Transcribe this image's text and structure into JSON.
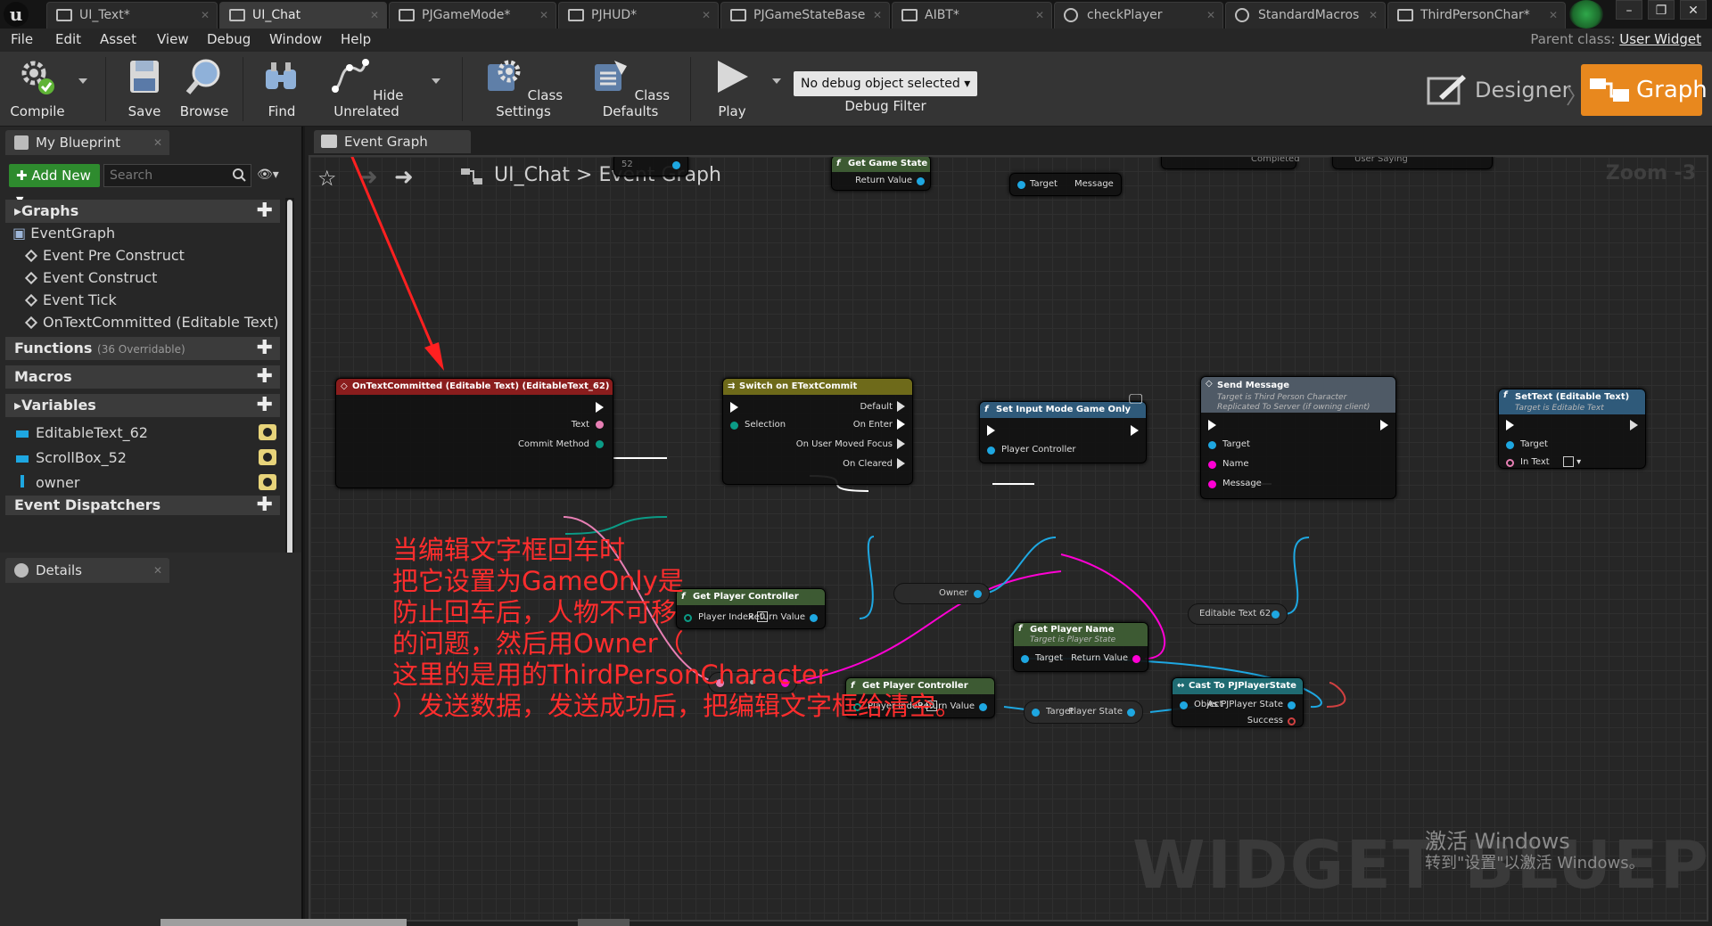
{
  "tabs": [
    {
      "label": "UI_Text*"
    },
    {
      "label": "UI_Chat"
    },
    {
      "label": "PJGameMode*"
    },
    {
      "label": "PJHUD*"
    },
    {
      "label": "PJGameStateBase"
    },
    {
      "label": "AIBT*"
    },
    {
      "label": "checkPlayer"
    },
    {
      "label": "StandardMacros"
    },
    {
      "label": "ThirdPersonChar*"
    }
  ],
  "menu": [
    "File",
    "Edit",
    "Asset",
    "View",
    "Debug",
    "Window",
    "Help"
  ],
  "parent_class": {
    "label": "Parent class:",
    "value": "User Widget"
  },
  "toolbar": {
    "compile": "Compile",
    "save": "Save",
    "browse": "Browse",
    "find": "Find",
    "hide_unrelated": "Hide Unrelated",
    "class_settings": "Class Settings",
    "class_defaults": "Class Defaults",
    "play": "Play",
    "debug_select": "No debug object selected",
    "debug_filter": "Debug Filter",
    "designer": "Designer",
    "graph": "Graph"
  },
  "my_blueprint": {
    "tab": "My Blueprint",
    "add_new": "Add New",
    "search_placeholder": "Search",
    "graphs": "Graphs",
    "event_graph": "EventGraph",
    "events": [
      "Event Pre Construct",
      "Event Construct",
      "Event Tick",
      "OnTextCommitted (Editable Text)"
    ],
    "functions": "Functions",
    "functions_sub": "(36 Overridable)",
    "macros": "Macros",
    "variables": "Variables",
    "vars": [
      "EditableText_62",
      "ScrollBox_52",
      "owner"
    ],
    "dispatchers": "Event Dispatchers"
  },
  "details": {
    "tab": "Details"
  },
  "graph": {
    "tab": "Event Graph",
    "crumb_bp": "UI_Chat",
    "crumb_sep": ">",
    "crumb_graph": "Event Graph",
    "zoom": "Zoom -3",
    "watermark": "WIDGET BLUEPRINT",
    "activate_line1": "激活 Windows",
    "activate_line2": "转到\"设置\"以激活 Windows。"
  },
  "nodes": {
    "top_get_game_state": {
      "title": "Get Game State",
      "out": "Return Value"
    },
    "top_target": "Target",
    "top_message": "Message",
    "top_completed": "Completed",
    "top_user_saying": "User Saying",
    "top_52": "52",
    "on_text_committed": {
      "title": "OnTextCommitted (Editable Text) (EditableText_62)",
      "text": "Text",
      "commit": "Commit Method"
    },
    "switch": {
      "title": "Switch on ETextCommit",
      "selection": "Selection",
      "default": "Default",
      "on_enter": "On Enter",
      "on_focus": "On User Moved Focus",
      "on_cleared": "On Cleared"
    },
    "set_input": {
      "title": "Set Input Mode Game Only",
      "pc": "Player Controller"
    },
    "send_message": {
      "title": "Send Message",
      "sub1": "Target is Third Person Character",
      "sub2": "Replicated To Server (if owning client)",
      "target": "Target",
      "name": "Name",
      "message": "Message"
    },
    "set_text": {
      "title": "SetText (Editable Text)",
      "sub": "Target is Editable Text",
      "target": "Target",
      "in_text": "In Text"
    },
    "get_pc_1": {
      "title": "Get Player Controller",
      "index": "Player Index",
      "index_val": "0",
      "out": "Return Value"
    },
    "owner": "Owner",
    "editable_text": "Editable Text 62",
    "get_player_name": {
      "title": "Get Player Name",
      "sub": "Target is Player State",
      "target": "Target",
      "out": "Return Value"
    },
    "get_pc_2": {
      "title": "Get Player Controller",
      "index": "Player Index",
      "index_val": "0",
      "out": "Return Value"
    },
    "player_state": {
      "target": "Target",
      "out": "Player State"
    },
    "cast": {
      "title": "Cast To PJPlayerState",
      "object": "Object",
      "as": "As PJPlayer State",
      "success": "Success"
    }
  },
  "annotation": [
    "当编辑文字框回车时",
    "把它设置为GameOnly是",
    "防止回车后，人物不可移",
    "的问题，然后用Owner（",
    "这里的是用的ThirdPersonCharacter",
    "）发送数据，发送成功后，把编辑文字框给清空。"
  ],
  "colors": {
    "accent": "#e8881e",
    "annotation": "#ff2d2d",
    "exec": "#ffffff",
    "object_pin": "#1ea7e1",
    "text_pin": "#e77fb4",
    "string_pin": "#ff00d4",
    "enum_pin": "#0b7a6b"
  }
}
